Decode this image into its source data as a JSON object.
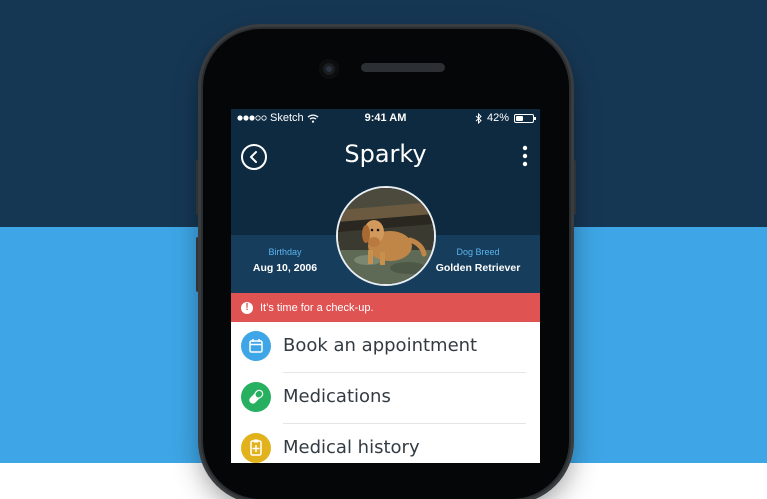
{
  "status_bar": {
    "carrier": "Sketch",
    "time": "9:41 AM",
    "battery": "42%",
    "battery_level": 0.42
  },
  "header": {
    "title": "Sparky",
    "back_icon": "back-chevron-circle-icon",
    "more_icon": "more-vertical-icon"
  },
  "pet": {
    "birthday_label": "Birthday",
    "birthday_value": "Aug 10, 2006",
    "breed_label": "Dog Breed",
    "breed_value": "Golden Retriever"
  },
  "alert": {
    "text": "It’s time for a check-up.",
    "icon": "exclamation-circle-icon",
    "color": "#e05353"
  },
  "menu": {
    "items": [
      {
        "label": "Book an appointment",
        "icon": "calendar-icon",
        "color": "#3ea6e6"
      },
      {
        "label": "Medications",
        "icon": "pill-icon",
        "color": "#26b05f"
      },
      {
        "label": "Medical history",
        "icon": "clipboard-icon",
        "color": "#e2b21c"
      }
    ]
  },
  "colors": {
    "background_top": "#163754",
    "background_bottom": "#3ea6e6",
    "header_bg": "#0d2a40",
    "info_band_bg": "#163d5c",
    "accent_label": "#5bb4f0"
  }
}
